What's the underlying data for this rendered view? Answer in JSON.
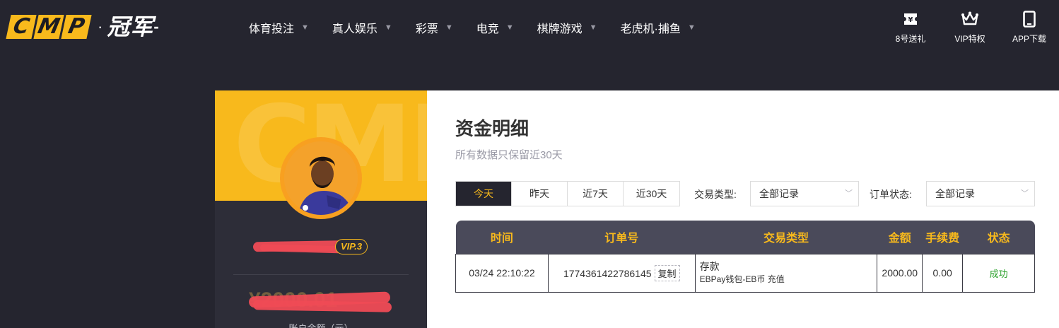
{
  "logo": {
    "letters": [
      "C",
      "M",
      "P"
    ],
    "dot": "·",
    "cn": "冠军",
    "tail": "-"
  },
  "nav": [
    {
      "label": "体育投注"
    },
    {
      "label": "真人娱乐"
    },
    {
      "label": "彩票"
    },
    {
      "label": "电竞"
    },
    {
      "label": "棋牌游戏"
    },
    {
      "label": "老虎机·捕鱼"
    }
  ],
  "top_icons": [
    {
      "icon": "ticket-icon",
      "label": "8号送礼"
    },
    {
      "icon": "crown-icon",
      "label": "VIP特权"
    },
    {
      "icon": "phone-icon",
      "label": "APP下载"
    }
  ],
  "card": {
    "watermark": "CMP",
    "vip": "VIP.3",
    "balance": "¥2000.01",
    "balance_label": "账户余额（元）"
  },
  "panel": {
    "title": "资金明细",
    "subtitle": "所有数据只保留近30天",
    "range_tabs": [
      "今天",
      "昨天",
      "近7天",
      "近30天"
    ],
    "active_range": "今天",
    "filters": {
      "type_label": "交易类型:",
      "type_value": "全部记录",
      "status_label": "订单状态:",
      "status_value": "全部记录"
    },
    "table": {
      "columns": [
        "时间",
        "订单号",
        "交易类型",
        "金额",
        "手续费",
        "状态"
      ],
      "rows": [
        {
          "time": "03/24 22:10:22",
          "order_no": "1774361422786145",
          "copy_label": "复制",
          "type_main": "存款",
          "type_sub": "EBPay钱包-EB币 充值",
          "amount": "2000.00",
          "fee": "0.00",
          "status": "成功"
        }
      ]
    }
  },
  "colors": {
    "accent": "#f8b91c",
    "bg": "#25252f",
    "success": "#2aa02a"
  }
}
